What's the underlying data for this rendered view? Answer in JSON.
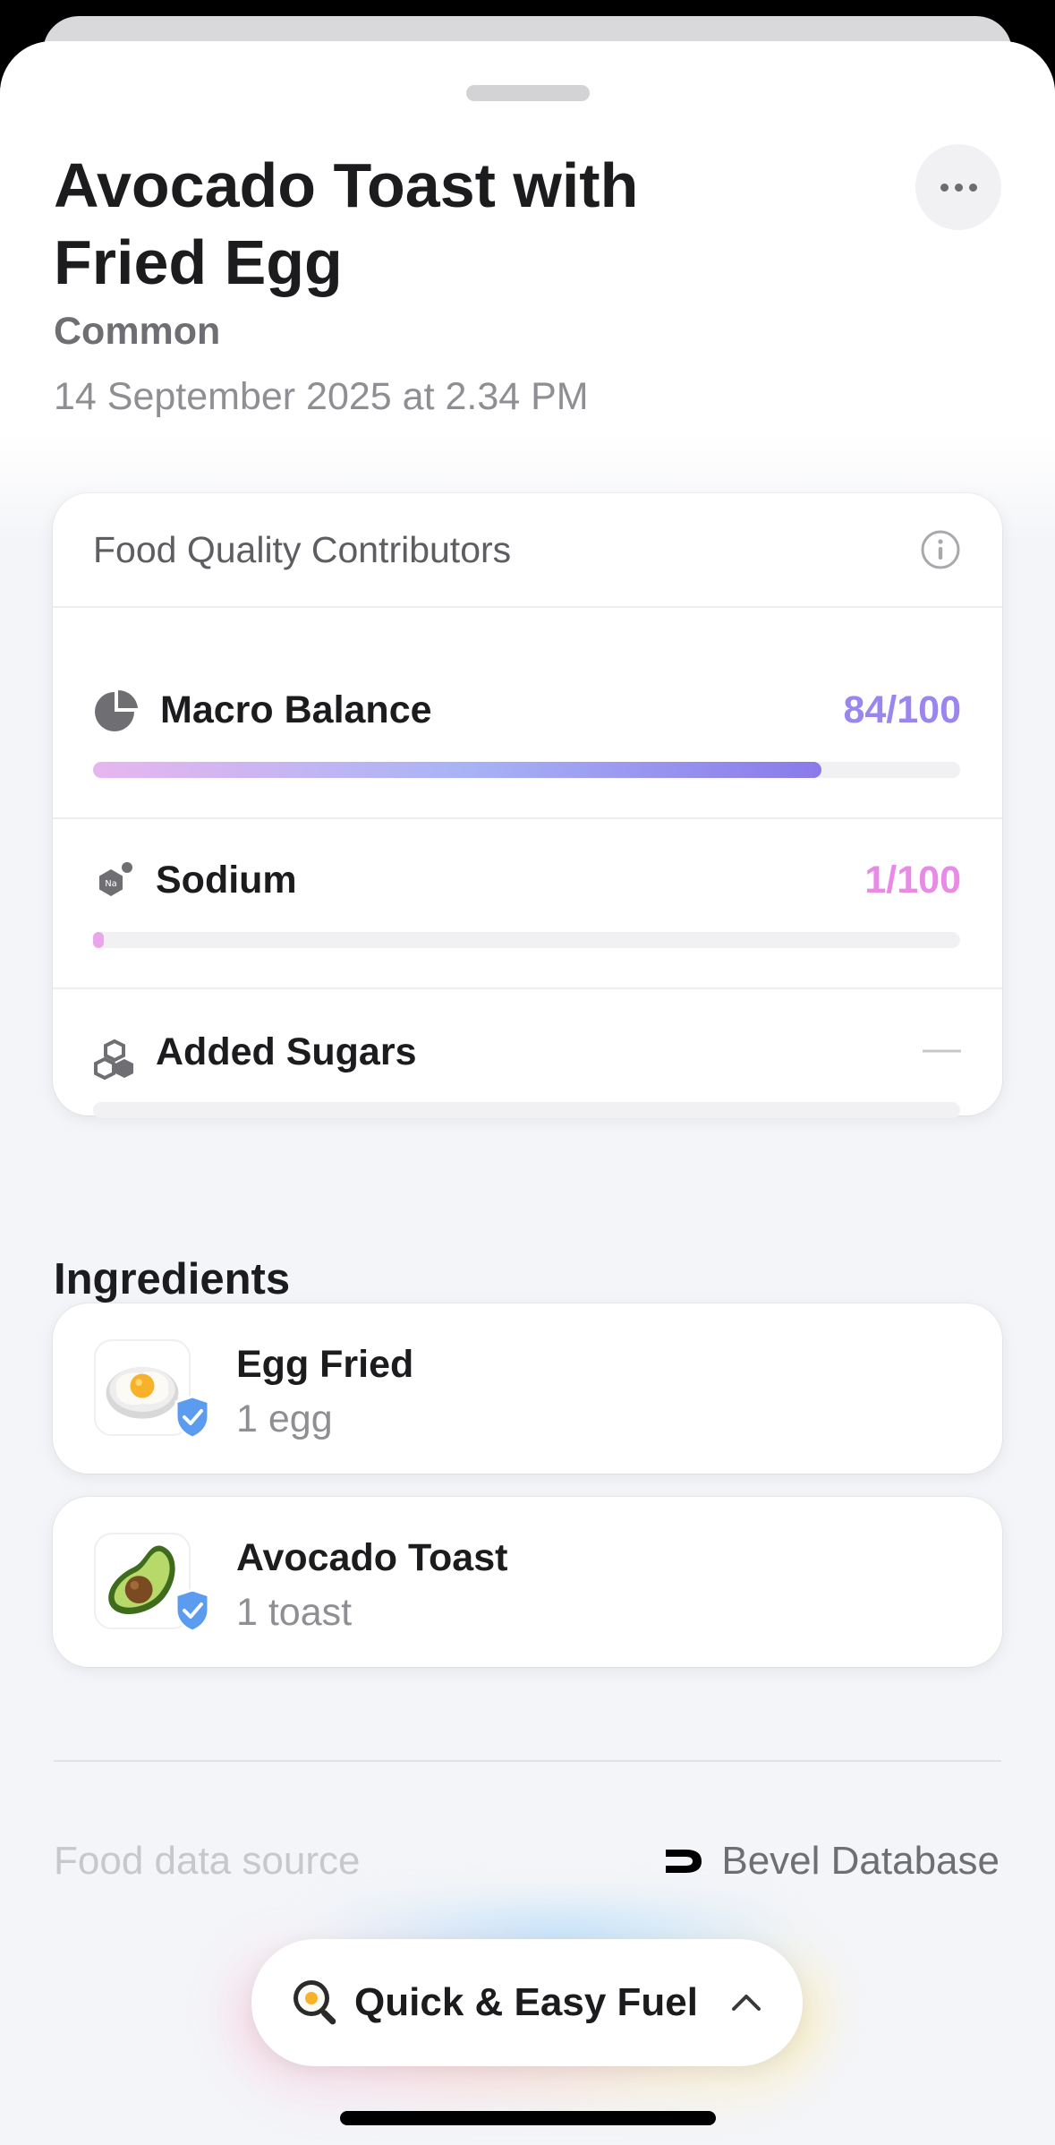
{
  "meal": {
    "title": "Avocado Toast with Fried Egg",
    "category": "Common",
    "datetime": "14 September 2025 at 2.34 PM"
  },
  "food_quality": {
    "header": "Food Quality Contributors",
    "contributors": [
      {
        "label": "Macro Balance",
        "value": "84/100",
        "score_fraction": 0.84,
        "color": "#9a86ee",
        "icon": "pie-chart-icon"
      },
      {
        "label": "Sodium",
        "value": "1/100",
        "score_fraction": 0.01,
        "color": "#e98ae6",
        "icon": "sodium-icon"
      },
      {
        "label": "Added Sugars",
        "value": "—",
        "score_fraction": 0,
        "color": "#c7c7cc",
        "icon": "sugar-cubes-icon"
      }
    ]
  },
  "ingredients": {
    "title": "Ingredients",
    "items": [
      {
        "name": "Egg Fried",
        "quantity": "1 egg",
        "icon": "fried-egg-icon",
        "verified": true
      },
      {
        "name": "Avocado Toast",
        "quantity": "1 toast",
        "icon": "avocado-icon",
        "verified": true
      }
    ]
  },
  "source": {
    "label": "Food data source",
    "value": "Bevel Database"
  },
  "bottom_pill": {
    "label": "Quick & Easy Fuel",
    "icon": "frying-pan-egg-icon"
  },
  "colors": {
    "accent_purple": "#9a86ee",
    "accent_pink": "#e98ae6",
    "verified_blue": "#5b9cf0"
  }
}
